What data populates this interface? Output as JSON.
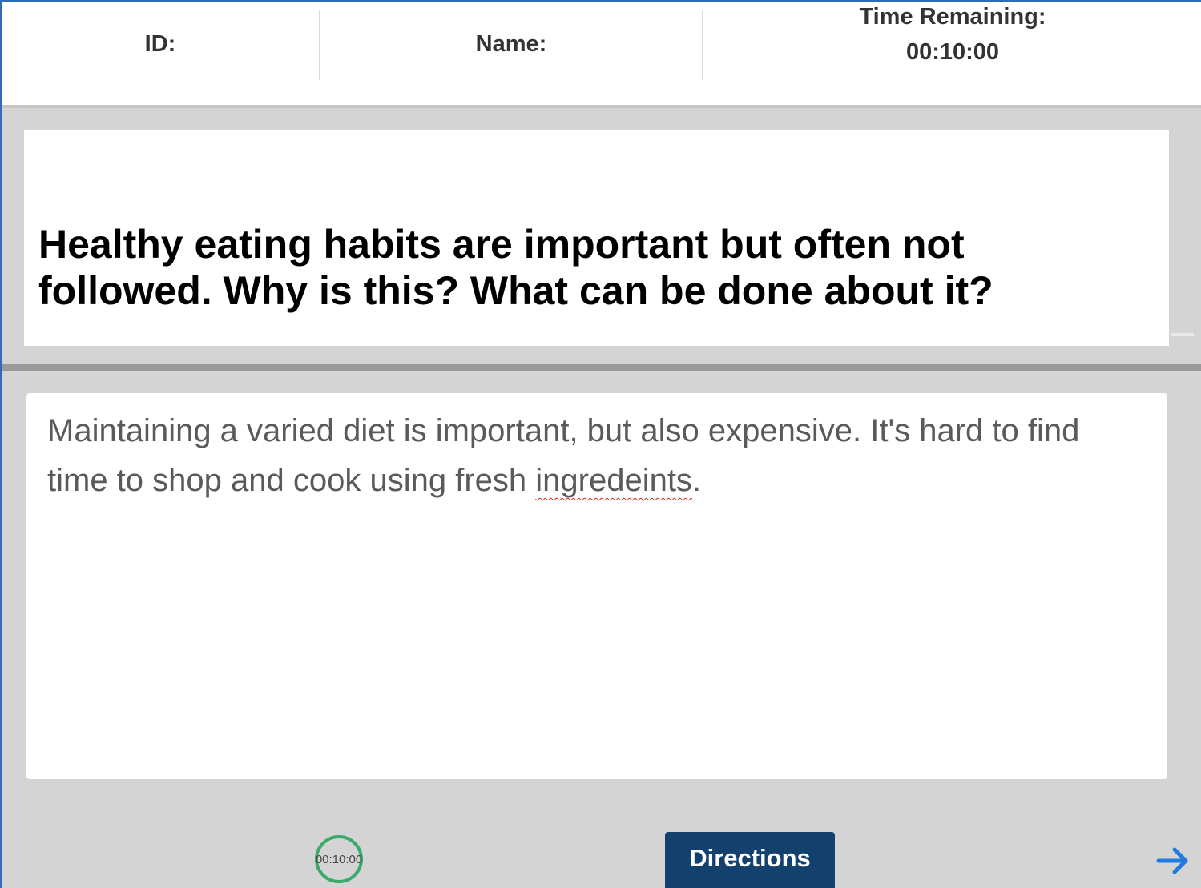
{
  "header": {
    "id_label": "ID:",
    "name_label": "Name:",
    "time_label": "Time Remaining:",
    "time_value": "00:10:00"
  },
  "prompt": {
    "line1": "Healthy eating habits are important but often not",
    "line2": "followed. Why is this? What can be done about it?"
  },
  "response": {
    "text_before": "Maintaining a varied diet is important, but also expensive. It's hard to find time to shop and cook using fresh ",
    "misspelled_word": "ingredeints",
    "text_after": "."
  },
  "footer": {
    "timer_text": "00:10:00",
    "timer_color": "#3aaa6a",
    "directions_label": "Directions",
    "directions_color": "#13416e",
    "next_icon": "arrow-right-icon",
    "next_color": "#1f7be0"
  }
}
